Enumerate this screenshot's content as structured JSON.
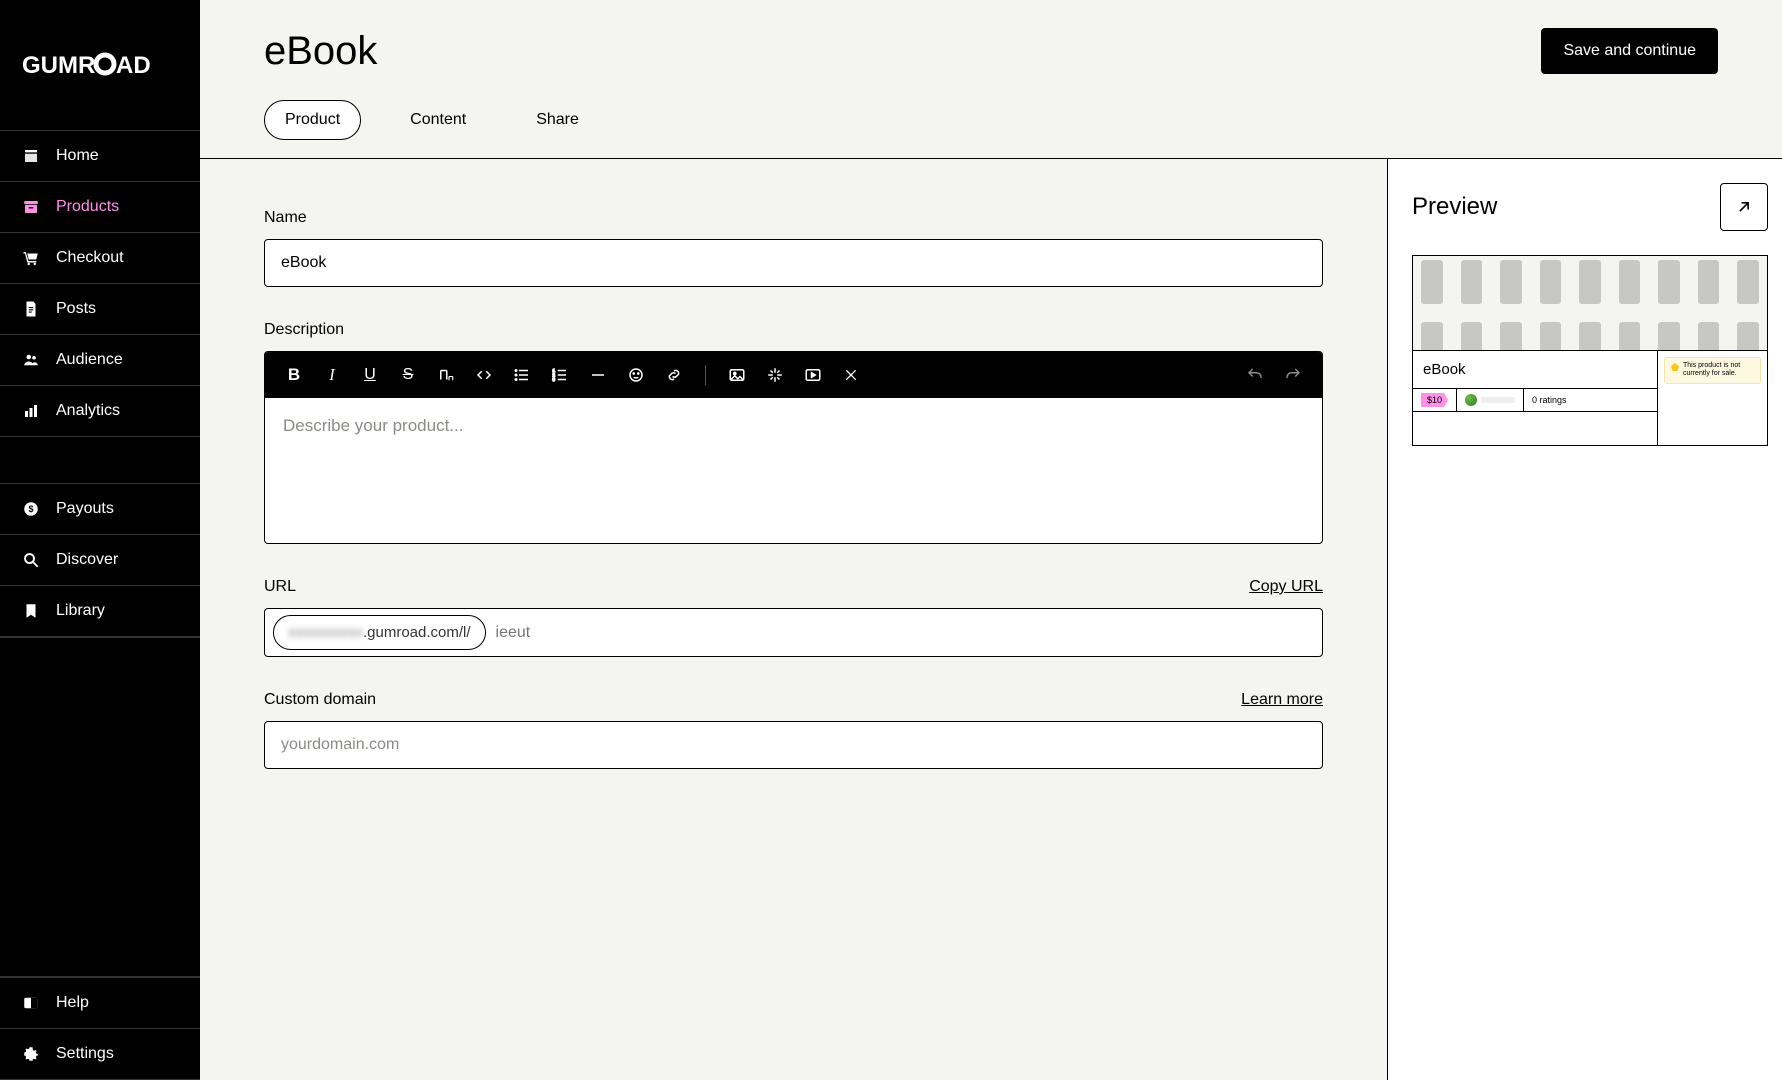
{
  "brand": "GUMROAD",
  "sidebar": {
    "groups": [
      [
        {
          "key": "home",
          "label": "Home",
          "icon": "shop-icon",
          "active": false
        },
        {
          "key": "products",
          "label": "Products",
          "icon": "archive-icon",
          "active": true
        },
        {
          "key": "checkout",
          "label": "Checkout",
          "icon": "cart-icon",
          "active": false
        },
        {
          "key": "posts",
          "label": "Posts",
          "icon": "file-icon",
          "active": false
        },
        {
          "key": "audience",
          "label": "Audience",
          "icon": "people-icon",
          "active": false
        },
        {
          "key": "analytics",
          "label": "Analytics",
          "icon": "chart-icon",
          "active": false
        }
      ],
      [
        {
          "key": "payouts",
          "label": "Payouts",
          "icon": "dollar-icon",
          "active": false
        },
        {
          "key": "discover",
          "label": "Discover",
          "icon": "search-icon",
          "active": false
        },
        {
          "key": "library",
          "label": "Library",
          "icon": "bookmark-icon",
          "active": false
        }
      ],
      [
        {
          "key": "help",
          "label": "Help",
          "icon": "help-icon",
          "active": false
        },
        {
          "key": "settings",
          "label": "Settings",
          "icon": "gear-icon",
          "active": false
        }
      ]
    ]
  },
  "header": {
    "title": "eBook",
    "primary_button": "Save and continue",
    "tabs": [
      {
        "key": "product",
        "label": "Product",
        "active": true
      },
      {
        "key": "content",
        "label": "Content",
        "active": false
      },
      {
        "key": "share",
        "label": "Share",
        "active": false
      }
    ]
  },
  "form": {
    "name": {
      "label": "Name",
      "value": "eBook"
    },
    "description": {
      "label": "Description",
      "placeholder": "Describe your product..."
    },
    "url": {
      "label": "URL",
      "copy_action": "Copy URL",
      "domain_suffix": ".gumroad.com/l/",
      "slug_placeholder": "ieeut"
    },
    "custom_domain": {
      "label": "Custom domain",
      "learn_more": "Learn more",
      "placeholder": "yourdomain.com"
    }
  },
  "preview": {
    "heading": "Preview",
    "product_title": "eBook",
    "price": "$10",
    "ratings_text": "0 ratings",
    "notice": "This product is not currently for sale."
  },
  "colors": {
    "accent": "#ff90e8",
    "bg": "#f4f4f0"
  }
}
